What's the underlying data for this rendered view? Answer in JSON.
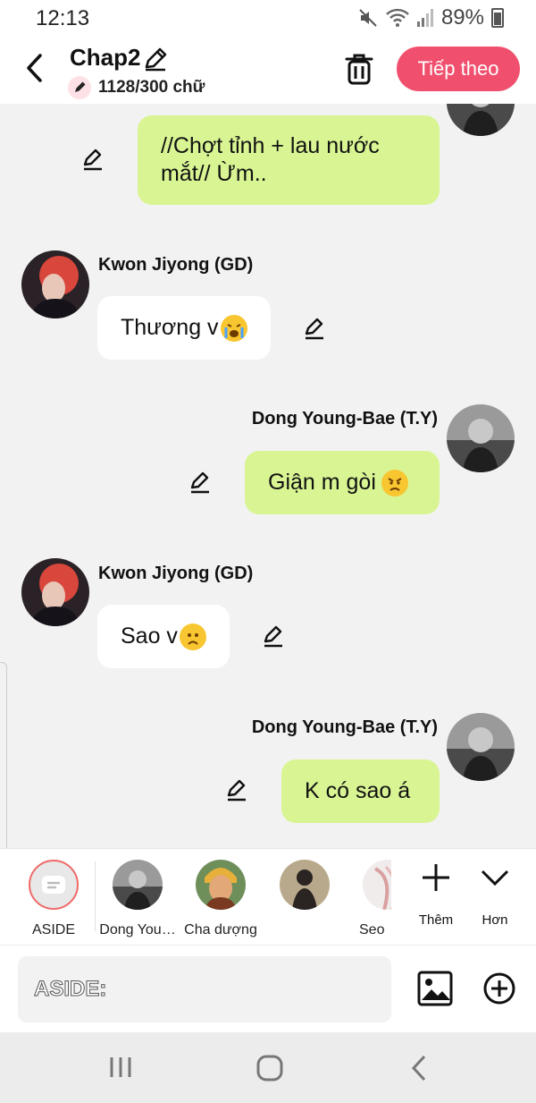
{
  "status": {
    "time": "12:13",
    "battery": "89%"
  },
  "header": {
    "title": "Chap2",
    "word_count": "1128/300 chữ",
    "next_label": "Tiếp theo",
    "accent": "#f0506e"
  },
  "messages": [
    {
      "side": "right",
      "text": "//Chợt tỉnh + lau nước mắt// Ừm.."
    },
    {
      "side": "left",
      "name": "Kwon Jiyong (GD)",
      "text": "Thương v",
      "emoji": "loudly-crying-face"
    },
    {
      "side": "right",
      "name": "Dong Young-Bae (T.Y)",
      "text": "Giận m gòi",
      "emoji": "angry-face"
    },
    {
      "side": "left",
      "name": "Kwon Jiyong (GD)",
      "text": "Sao v",
      "emoji": "worried-face"
    },
    {
      "side": "right",
      "name": "Dong Young-Bae (T.Y)",
      "text": "K có sao á"
    }
  ],
  "characters": [
    {
      "label": "ASIDE"
    },
    {
      "label": "Dong You…"
    },
    {
      "label": "Cha dượng"
    },
    {
      "label": ""
    },
    {
      "label": "Seo"
    }
  ],
  "actions": {
    "more_label": "Thêm",
    "less_label": "Hơn"
  },
  "input": {
    "placeholder": "ASIDE:"
  },
  "colors": {
    "my_bubble": "#d9f593",
    "other_bubble": "#ffffff",
    "chat_bg": "#f2f2f2"
  }
}
